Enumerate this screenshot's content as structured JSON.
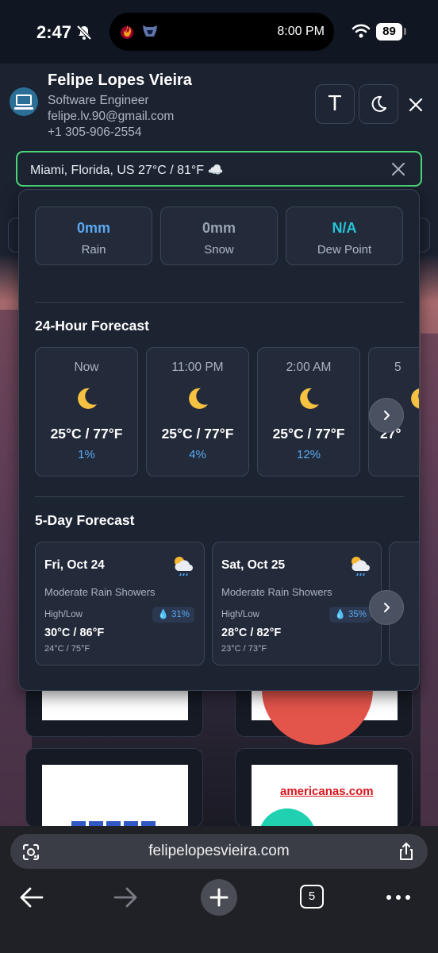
{
  "status_bar": {
    "time": "2:47",
    "island_time": "8:00 PM",
    "battery": "89",
    "icons": [
      "bell-slash-icon",
      "miami-heat-logo",
      "memphis-grizzlies-logo",
      "wifi-icon",
      "battery-icon"
    ]
  },
  "profile": {
    "name": "Felipe Lopes Vieira",
    "role": "Software Engineer",
    "email": "felipe.lv.90@gmail.com",
    "phone": "+1 305-906-2554"
  },
  "header_buttons": {
    "font_label": "T",
    "icons": [
      "font-size-icon",
      "moon-icon",
      "close-icon"
    ]
  },
  "search": {
    "value": "Miami, Florida, US 27°C / 81°F ☁️"
  },
  "weather": {
    "metrics": [
      {
        "value": "0mm",
        "label": "Rain",
        "color": "#5aa8f0"
      },
      {
        "value": "0mm",
        "label": "Snow",
        "color": "#9aa3b2"
      },
      {
        "value": "N/A",
        "label": "Dew Point",
        "color": "#27c4d8"
      }
    ],
    "hourly_title": "24-Hour Forecast",
    "hourly": [
      {
        "time": "Now",
        "icon": "crescent-moon-icon",
        "temp": "25°C / 77°F",
        "precip": "1%"
      },
      {
        "time": "11:00 PM",
        "icon": "crescent-moon-icon",
        "temp": "25°C / 77°F",
        "precip": "4%"
      },
      {
        "time": "2:00 AM",
        "icon": "crescent-moon-icon",
        "temp": "25°C / 77°F",
        "precip": "12%"
      },
      {
        "time": "5",
        "icon": "crescent-moon-icon",
        "temp": "27°",
        "precip": ""
      }
    ],
    "daily_title": "5-Day Forecast",
    "daily": [
      {
        "date": "Fri, Oct 24",
        "icon": "sun-behind-rain-cloud-icon",
        "condition": "Moderate Rain Showers",
        "hl_label": "High/Low",
        "precip": "💧 31%",
        "high": "30°C / 86°F",
        "low": "24°C / 75°F"
      },
      {
        "date": "Sat, Oct 25",
        "icon": "sun-behind-rain-cloud-icon",
        "condition": "Moderate Rain Showers",
        "hl_label": "High/Low",
        "precip": "💧 35%",
        "high": "28°C / 82°F",
        "low": "23°C / 73°F"
      }
    ]
  },
  "background": {
    "logo_text": "americanas.com"
  },
  "browser": {
    "url": "felipelopesvieira.com",
    "tab_count": "5"
  }
}
